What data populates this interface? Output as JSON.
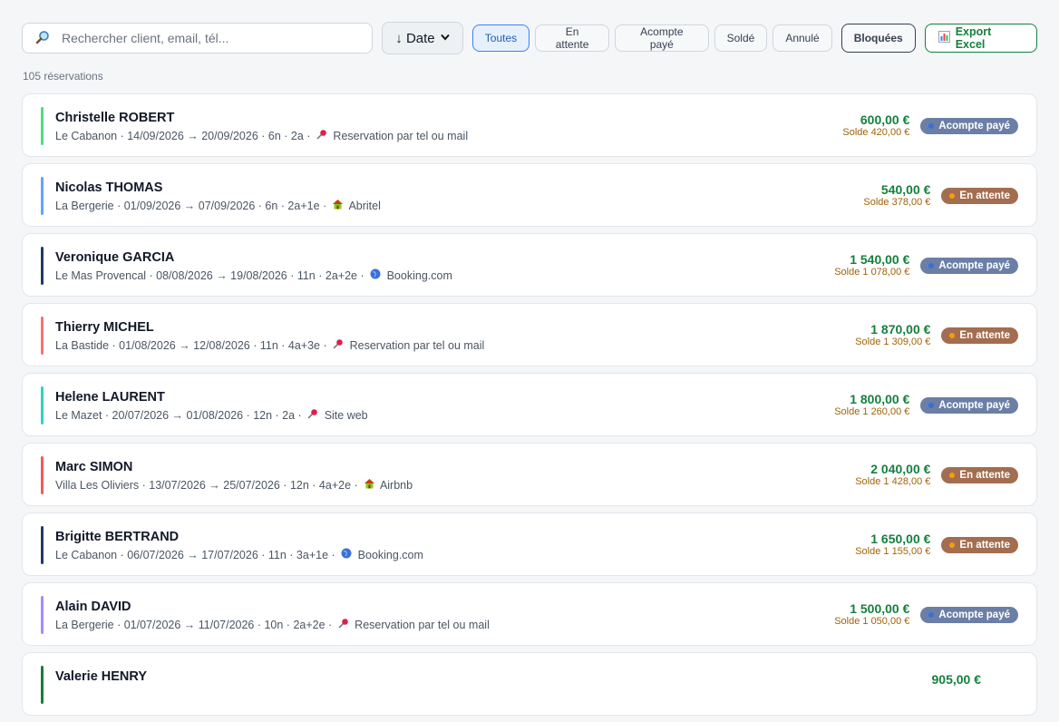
{
  "search": {
    "placeholder": "Rechercher client, email, tél..."
  },
  "sort": {
    "label": "↓ Date"
  },
  "filters": [
    "Toutes",
    "En attente",
    "Acompte payé",
    "Soldé",
    "Annulé"
  ],
  "blocked_label": "Bloquées",
  "export_label": "Export Excel",
  "count_label": "105 réservations",
  "colors": {
    "acompte_badge": "#6b7fa6",
    "acompte_dot": "#3b6fd8",
    "attente_badge": "#a36d50",
    "attente_dot": "#f59e0b",
    "total": "#15803d",
    "solde": "#a16207"
  },
  "reservations": [
    {
      "name": "Christelle ROBERT",
      "details": "Le Cabanon · 14/09/2026 → 20/09/2026 · 6n · 2a ·",
      "source_icon": "pushpin-icon",
      "source": "Reservation par tel ou mail",
      "total": "600,00 €",
      "solde": "Solde 420,00 €",
      "status": "Acompte payé",
      "status_type": "acompte",
      "bar_color": "#4ade80"
    },
    {
      "name": "Nicolas THOMAS",
      "details": "La Bergerie · 01/09/2026 → 07/09/2026 · 6n · 2a+1e ·",
      "source_icon": "house-icon",
      "source": "Abritel",
      "total": "540,00 €",
      "solde": "Solde 378,00 €",
      "status": "En attente",
      "status_type": "attente",
      "bar_color": "#60a5fa"
    },
    {
      "name": "Veronique GARCIA",
      "details": "Le Mas Provencal · 08/08/2026 → 19/08/2026 · 11n · 2a+2e ·",
      "source_icon": "globe-icon",
      "source": "Booking.com",
      "total": "1 540,00 €",
      "solde": "Solde 1 078,00 €",
      "status": "Acompte payé",
      "status_type": "acompte",
      "bar_color": "#1e3a6e"
    },
    {
      "name": "Thierry MICHEL",
      "details": "La Bastide · 01/08/2026 → 12/08/2026 · 11n · 4a+3e ·",
      "source_icon": "pushpin-icon",
      "source": "Reservation par tel ou mail",
      "total": "1 870,00 €",
      "solde": "Solde 1 309,00 €",
      "status": "En attente",
      "status_type": "attente",
      "bar_color": "#f87171"
    },
    {
      "name": "Helene LAURENT",
      "details": "Le Mazet · 20/07/2026 → 01/08/2026 · 12n · 2a ·",
      "source_icon": "pushpin-icon",
      "source": "Site web",
      "total": "1 800,00 €",
      "solde": "Solde 1 260,00 €",
      "status": "Acompte payé",
      "status_type": "acompte",
      "bar_color": "#2dd4bf"
    },
    {
      "name": "Marc SIMON",
      "details": "Villa Les Oliviers · 13/07/2026 → 25/07/2026 · 12n · 4a+2e ·",
      "source_icon": "house-icon",
      "source": "Airbnb",
      "total": "2 040,00 €",
      "solde": "Solde 1 428,00 €",
      "status": "En attente",
      "status_type": "attente",
      "bar_color": "#f05a5a"
    },
    {
      "name": "Brigitte BERTRAND",
      "details": "Le Cabanon · 06/07/2026 → 17/07/2026 · 11n · 3a+1e ·",
      "source_icon": "globe-icon",
      "source": "Booking.com",
      "total": "1 650,00 €",
      "solde": "Solde 1 155,00 €",
      "status": "En attente",
      "status_type": "attente",
      "bar_color": "#1e3a6e"
    },
    {
      "name": "Alain DAVID",
      "details": "La Bergerie · 01/07/2026 → 11/07/2026 · 10n · 2a+2e ·",
      "source_icon": "pushpin-icon",
      "source": "Reservation par tel ou mail",
      "total": "1 500,00 €",
      "solde": "Solde 1 050,00 €",
      "status": "Acompte payé",
      "status_type": "acompte",
      "bar_color": "#a78bfa"
    },
    {
      "name": "Valerie HENRY",
      "details": "",
      "source_icon": "",
      "source": "",
      "total": "905,00 €",
      "solde": "",
      "status": "",
      "status_type": "attente",
      "bar_color": "#16803d"
    }
  ]
}
